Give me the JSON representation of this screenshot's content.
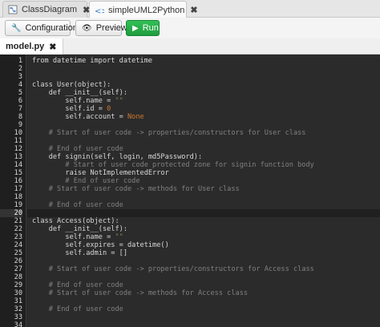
{
  "tabs": [
    {
      "label": "ClassDiagram",
      "active": false,
      "icon": "diagram-icon"
    },
    {
      "label": "simpleUML2Python",
      "active": true,
      "icon": "transform-icon"
    }
  ],
  "toolbar": {
    "configuration_label": "Configuration",
    "preview_label": "Preview",
    "run_label": "Run",
    "run_color": "#1f9c3e"
  },
  "file_tab": {
    "label": "model.py"
  },
  "current_line": 20,
  "code_lines": [
    {
      "n": "1",
      "tokens": [
        {
          "t": "from datetime import datetime",
          "c": "default"
        }
      ]
    },
    {
      "n": "2",
      "tokens": []
    },
    {
      "n": "3",
      "tokens": []
    },
    {
      "n": "4",
      "tokens": [
        {
          "t": "class User(object):",
          "c": "default"
        }
      ]
    },
    {
      "n": "5",
      "tokens": [
        {
          "t": "    def __init__(self):",
          "c": "default"
        }
      ]
    },
    {
      "n": "6",
      "tokens": [
        {
          "t": "        self.name = ",
          "c": "default"
        },
        {
          "t": "\"\"",
          "c": "str"
        }
      ]
    },
    {
      "n": "7",
      "tokens": [
        {
          "t": "        self.id = ",
          "c": "default"
        },
        {
          "t": "0",
          "c": "num"
        }
      ]
    },
    {
      "n": "8",
      "tokens": [
        {
          "t": "        self.account = ",
          "c": "default"
        },
        {
          "t": "None",
          "c": "kw"
        }
      ]
    },
    {
      "n": "9",
      "tokens": []
    },
    {
      "n": "10",
      "tokens": [
        {
          "t": "    # Start of user code -> properties/constructors for User class",
          "c": "comment"
        }
      ]
    },
    {
      "n": "11",
      "tokens": []
    },
    {
      "n": "12",
      "tokens": [
        {
          "t": "    # End of user code",
          "c": "comment"
        }
      ]
    },
    {
      "n": "13",
      "tokens": [
        {
          "t": "    def signin(self, login, md5Password):",
          "c": "default"
        }
      ]
    },
    {
      "n": "14",
      "tokens": [
        {
          "t": "        # Start of user code protected zone for signin function body",
          "c": "comment"
        }
      ]
    },
    {
      "n": "15",
      "tokens": [
        {
          "t": "        raise NotImplementedError",
          "c": "default"
        }
      ]
    },
    {
      "n": "16",
      "tokens": [
        {
          "t": "        # End of user code",
          "c": "comment"
        }
      ]
    },
    {
      "n": "17",
      "tokens": [
        {
          "t": "    # Start of user code -> methods for User class",
          "c": "comment"
        }
      ]
    },
    {
      "n": "18",
      "tokens": []
    },
    {
      "n": "19",
      "tokens": [
        {
          "t": "    # End of user code",
          "c": "comment"
        }
      ]
    },
    {
      "n": "20",
      "tokens": []
    },
    {
      "n": "21",
      "tokens": [
        {
          "t": "class Access(object):",
          "c": "default"
        }
      ]
    },
    {
      "n": "22",
      "tokens": [
        {
          "t": "    def __init__(self):",
          "c": "default"
        }
      ]
    },
    {
      "n": "23",
      "tokens": [
        {
          "t": "        self.name = ",
          "c": "default"
        },
        {
          "t": "\"\"",
          "c": "str"
        }
      ]
    },
    {
      "n": "24",
      "tokens": [
        {
          "t": "        self.expires = datetime()",
          "c": "default"
        }
      ]
    },
    {
      "n": "25",
      "tokens": [
        {
          "t": "        self.admin = []",
          "c": "default"
        }
      ]
    },
    {
      "n": "26",
      "tokens": []
    },
    {
      "n": "27",
      "tokens": [
        {
          "t": "    # Start of user code -> properties/constructors for Access class",
          "c": "comment"
        }
      ]
    },
    {
      "n": "28",
      "tokens": []
    },
    {
      "n": "29",
      "tokens": [
        {
          "t": "    # End of user code",
          "c": "comment"
        }
      ]
    },
    {
      "n": "30",
      "tokens": [
        {
          "t": "    # Start of user code -> methods for Access class",
          "c": "comment"
        }
      ]
    },
    {
      "n": "31",
      "tokens": []
    },
    {
      "n": "32",
      "tokens": [
        {
          "t": "    # End of user code",
          "c": "comment"
        }
      ]
    },
    {
      "n": "33",
      "tokens": []
    },
    {
      "n": "34",
      "tokens": []
    }
  ]
}
